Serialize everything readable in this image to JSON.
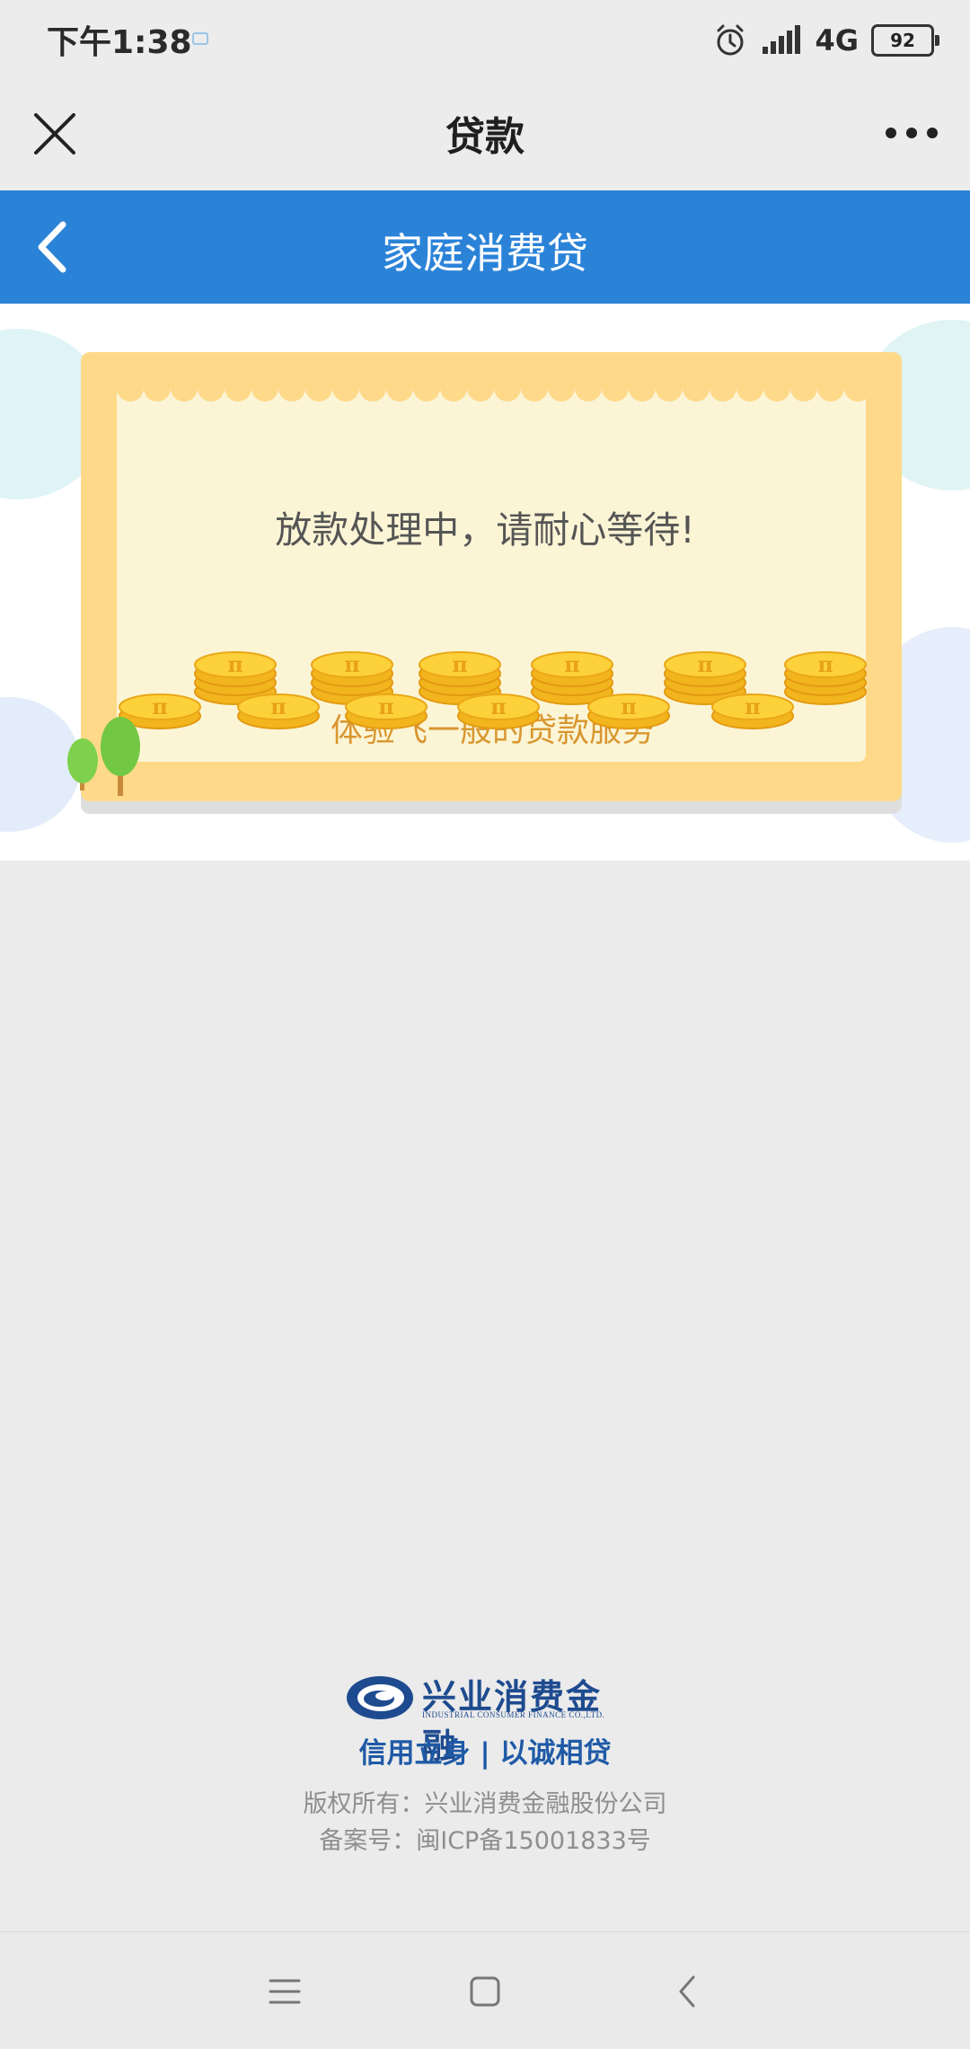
{
  "status_bar": {
    "time": "下午1:38",
    "network": "4G",
    "battery": "92"
  },
  "title_bar": {
    "title": "贷款"
  },
  "header": {
    "title": "家庭消费贷"
  },
  "banner": {
    "message": "放款处理中，请耐心等待!",
    "subtitle": "体验飞一般的贷款服务",
    "coin_symbol": "π"
  },
  "footer": {
    "logo_cn": "兴业消费金融",
    "logo_en": "INDUSTRIAL CONSUMER FINANCE CO.,LTD.",
    "slogan": "信用立身 | 以诚相贷",
    "copyright": "版权所有：兴业消费金融股份公司",
    "icp": "备案号：闽ICP备15001833号"
  },
  "colors": {
    "header_blue": "#2b83d8",
    "card_frame": "#ffd98a",
    "card_paper": "#fbf5d6",
    "subtitle_orange": "#d9962f",
    "coin_gold": "#f7c123",
    "brand_blue": "#1f5aa6"
  },
  "icons": {
    "close": "close-icon",
    "more": "more-icon",
    "back": "chevron-left-icon",
    "alarm": "alarm-icon",
    "signal": "signal-icon",
    "battery": "battery-icon",
    "nav_menu": "menu-icon",
    "nav_home": "home-icon",
    "nav_back": "back-icon"
  }
}
